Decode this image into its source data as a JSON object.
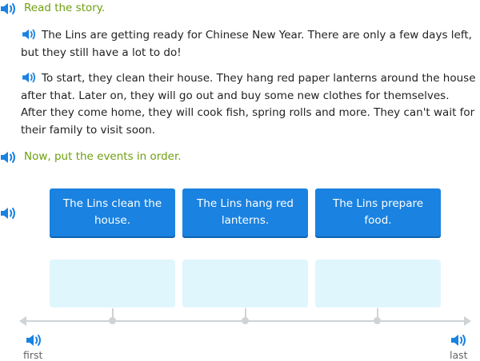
{
  "read_prompt": "Read the story.",
  "story": {
    "paragraph1": "The Lins are getting ready for Chinese New Year. There are only a few days left, but they still have a lot to do!",
    "paragraph2": "To start, they clean their house. They hang red paper lanterns around the house after that. Later on, they will go out and buy some new clothes for themselves. After they come home, they will cook fish, spring rolls and more. They can't wait for their family to visit soon."
  },
  "order_prompt": "Now, put the events in order.",
  "cards": [
    {
      "label": "The Lins clean the house."
    },
    {
      "label": "The Lins hang red lanterns."
    },
    {
      "label": "The Lins prepare food."
    }
  ],
  "timeline": {
    "first_label": "first",
    "last_label": "last"
  },
  "colors": {
    "accent_green": "#6f9e10",
    "card_blue": "#1a82e0",
    "slot_bg": "#dff6fd",
    "speaker_blue": "#1a82e0"
  }
}
